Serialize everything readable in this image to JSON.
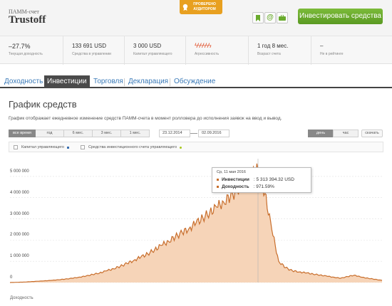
{
  "header": {
    "pamm_label": "ПАММ-счет",
    "account_name": "Trustoff",
    "verified_badge": "ПРОВЕРЕНО АУДИТОРОМ",
    "invest_button": "Инвестировать средства"
  },
  "stats": [
    {
      "value": "–27.7%",
      "label": "Текущая доходность"
    },
    {
      "value": "133 691 USD",
      "label": "Средства в управлении"
    },
    {
      "value": "3 000 USD",
      "label": "Капитал управляющего"
    },
    {
      "value": "",
      "label": "Агрессивность"
    },
    {
      "value": "1 год 8 мес.",
      "label": "Возраст счета"
    },
    {
      "value": "–",
      "label": "Не в рейтинге"
    }
  ],
  "tabs": [
    "Доходность",
    "Инвестиции",
    "Торговля",
    "Декларация",
    "Обсуждение"
  ],
  "active_tab": "Инвестиции",
  "chart_panel": {
    "title": "График средств",
    "description": "График отображает ежедневное изменение средств ПАММ-счета в момент ролловера до исполнения заявок на ввод и вывод.",
    "periods": [
      "все время",
      "год",
      "6 мес.",
      "3 мес.",
      "1 мес."
    ],
    "date_from": "23.12.2014",
    "date_to": "02.09.2016",
    "granularity": [
      "день",
      "час"
    ],
    "download": "скачать",
    "legend": [
      "Капитал управляющего",
      "Средства инвестиционного счета управляющего"
    ],
    "x_caption": "Доходность"
  },
  "tooltip": {
    "date": "Ср, 11 мая 2016",
    "investments_label": "Инвестиции",
    "investments_value": ": 5 313 394.32  USD",
    "return_label": "Доходность",
    "return_value": ": 971.59%"
  },
  "colors": {
    "accent_green": "#6aab2e",
    "badge_orange": "#e8a020",
    "series_fill": "#f6d4b8",
    "series_line": "#c86e2c",
    "tab_active": "#4a4a4a",
    "link": "#3a7ab8"
  },
  "chart_data": {
    "type": "area",
    "title": "",
    "xlabel": "",
    "ylabel": "",
    "ylim": [
      0,
      5500000
    ],
    "yticks": [
      "0",
      "1 000 000",
      "2 000 000",
      "3 000 000",
      "4 000 000",
      "5 000 000"
    ],
    "series": [
      {
        "name": "Инвестиции",
        "x_range": [
          "2014-12-23",
          "2016-09-02"
        ],
        "values": [
          0,
          10000,
          20000,
          40000,
          60000,
          80000,
          100000,
          130000,
          160000,
          200000,
          250000,
          300000,
          380000,
          450000,
          550000,
          650000,
          760000,
          900000,
          1050000,
          1200000,
          1350000,
          1550000,
          1750000,
          1950000,
          2150000,
          2350000,
          2550000,
          2800000,
          3050000,
          3300000,
          3550000,
          3800000,
          4050000,
          4350000,
          4700000,
          5100000,
          5313394,
          4200000,
          2500000,
          1000000,
          700000,
          550000,
          500000,
          450000,
          400000,
          350000,
          300000,
          250000,
          200000,
          280000,
          350000,
          250000,
          200000,
          150000,
          100000
        ]
      }
    ]
  }
}
